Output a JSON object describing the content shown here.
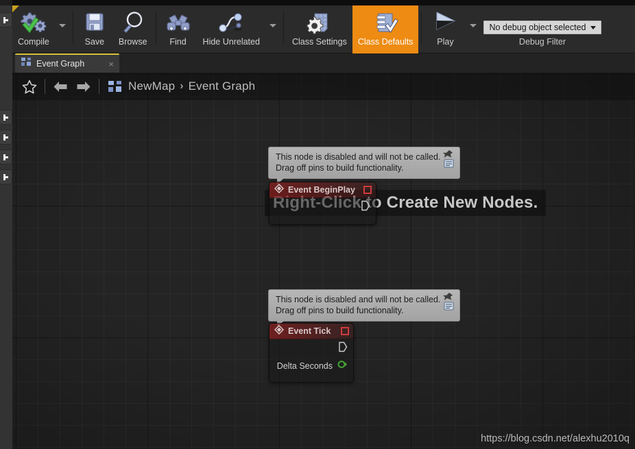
{
  "window": {
    "title_strip": ""
  },
  "toolbar": {
    "items": [
      {
        "id": "compile",
        "label": "Compile",
        "icon": "compile-gears-check-icon",
        "has_dropdown": true,
        "active": false
      },
      {
        "id": "save",
        "label": "Save",
        "icon": "floppy-disk-icon",
        "has_dropdown": false,
        "active": false
      },
      {
        "id": "browse",
        "label": "Browse",
        "icon": "magnifier-icon",
        "has_dropdown": false,
        "active": false
      },
      {
        "id": "find",
        "label": "Find",
        "icon": "binoculars-icon",
        "has_dropdown": false,
        "active": false
      },
      {
        "id": "hide-unrelated",
        "label": "Hide Unrelated",
        "icon": "node-graph-icon",
        "has_dropdown": true,
        "active": false
      },
      {
        "id": "class-settings",
        "label": "Class Settings",
        "icon": "gear-document-icon",
        "has_dropdown": false,
        "active": false
      },
      {
        "id": "class-defaults",
        "label": "Class Defaults",
        "icon": "checklist-icon",
        "has_dropdown": false,
        "active": true
      },
      {
        "id": "play",
        "label": "Play",
        "icon": "play-triangle-icon",
        "has_dropdown": true,
        "active": false
      }
    ],
    "debug": {
      "value": "No debug object selected",
      "label": "Debug Filter"
    },
    "accent_color": "#ee8b12"
  },
  "tabs": [
    {
      "id": "event-graph",
      "label": "Event Graph",
      "icon": "blueprint-graph-icon",
      "closable": true,
      "active": true,
      "close_glyph": "×"
    }
  ],
  "breadcrumb": {
    "favorite_glyph": "☆",
    "back_glyph": "←",
    "forward_glyph": "→",
    "icon": "blueprint-graph-icon",
    "separator": "›",
    "parts": [
      "NewMap",
      "Event Graph"
    ]
  },
  "graph": {
    "hint_text": "Right-Click to Create New Nodes.",
    "comments": [
      {
        "id": "comment-beginplay",
        "line1": "This node is disabled and will not be called.",
        "line2": "Drag off pins to build functionality.",
        "icons": [
          "pin-icon",
          "comment-bubble-icon"
        ]
      },
      {
        "id": "comment-tick",
        "line1": "This node is disabled and will not be called.",
        "line2": "Drag off pins to build functionality.",
        "icons": [
          "pin-icon",
          "comment-bubble-icon"
        ]
      }
    ],
    "nodes": [
      {
        "id": "event-beginplay",
        "title": "Event BeginPlay",
        "title_icon": "event-diamond-icon",
        "disabled_badge": "disabled-red-square-icon",
        "exec_out_glyph": "exec-pin-icon",
        "pins": []
      },
      {
        "id": "event-tick",
        "title": "Event Tick",
        "title_icon": "event-diamond-icon",
        "disabled_badge": "disabled-red-square-icon",
        "exec_out_glyph": "exec-pin-icon",
        "pins": [
          {
            "label": "Delta Seconds",
            "type": "float",
            "color": "#44a033",
            "icon": "float-pin-icon"
          }
        ]
      }
    ],
    "watermark": "https://blog.csdn.net/alexhu2010q"
  },
  "left_rail": {
    "buttons": [
      {
        "id": "rail-top",
        "icon": "chevron-right-icon"
      },
      {
        "id": "rail-1",
        "icon": "chevron-right-icon"
      },
      {
        "id": "rail-2",
        "icon": "chevron-right-icon"
      },
      {
        "id": "rail-3",
        "icon": "chevron-right-icon"
      },
      {
        "id": "rail-4",
        "icon": "chevron-right-icon"
      }
    ]
  }
}
